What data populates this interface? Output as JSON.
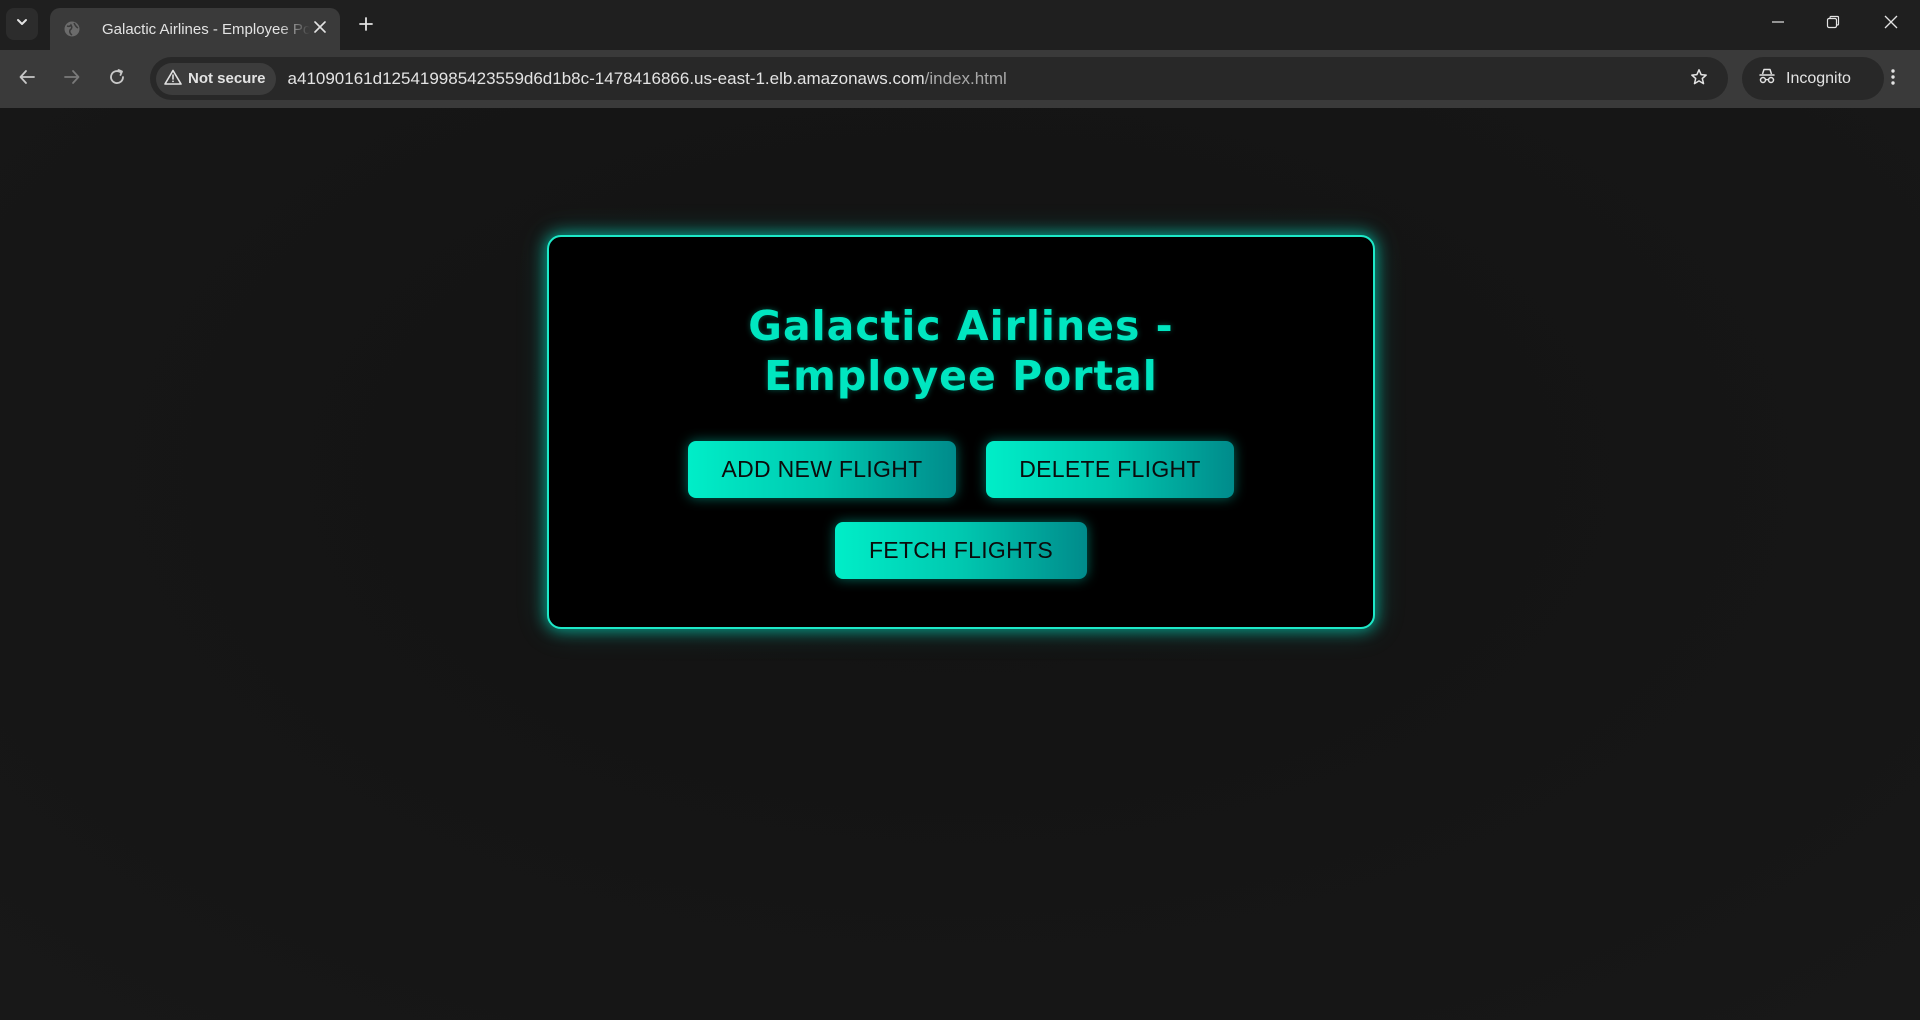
{
  "browser": {
    "tab": {
      "title": "Galactic Airlines - Employee Portal"
    },
    "security_label": "Not secure",
    "url": {
      "host": "a41090161d125419985423559d6d1b8c-1478416866.us-east-1.elb.amazonaws.com",
      "path": "/index.html"
    },
    "profile_label": "Incognito",
    "icons": {
      "tab_search": "chevron-down-icon",
      "favicon": "globe-icon",
      "tab_close": "close-icon",
      "new_tab": "plus-icon",
      "minimize": "minimize-icon",
      "restore": "restore-icon",
      "close_window": "close-icon",
      "back": "arrow-left-icon",
      "forward": "arrow-right-icon",
      "reload": "reload-icon",
      "warning": "warning-icon",
      "bookmark": "star-icon",
      "incognito": "incognito-icon",
      "menu": "kebab-menu-icon"
    }
  },
  "page": {
    "heading": "Galactic Airlines - Employee Portal",
    "buttons": {
      "add_flight": "ADD NEW FLIGHT",
      "delete_flight": "DELETE FLIGHT",
      "fetch_flights": "FETCH FLIGHTS"
    }
  },
  "colors": {
    "accent": "#00e6c0",
    "card_background": "#000000",
    "page_background": "#161616"
  }
}
